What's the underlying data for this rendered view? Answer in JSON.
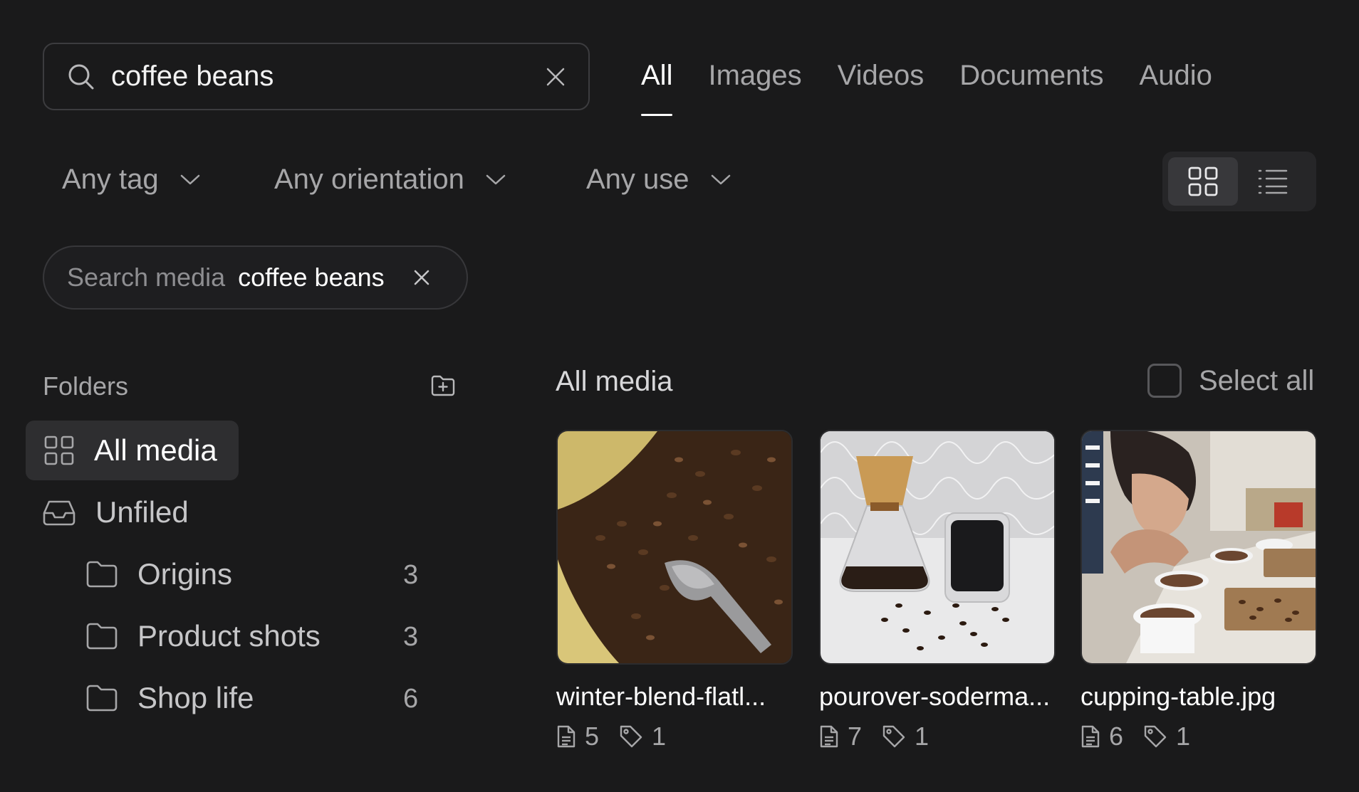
{
  "search": {
    "value": "coffee beans",
    "placeholder": "Search media"
  },
  "tabs": [
    {
      "label": "All",
      "active": true
    },
    {
      "label": "Images",
      "active": false
    },
    {
      "label": "Videos",
      "active": false
    },
    {
      "label": "Documents",
      "active": false
    },
    {
      "label": "Audio",
      "active": false
    }
  ],
  "filters": [
    {
      "label": "Any tag"
    },
    {
      "label": "Any orientation"
    },
    {
      "label": "Any use"
    }
  ],
  "view_mode": "grid",
  "chip": {
    "label": "Search media",
    "value": "coffee beans"
  },
  "sidebar": {
    "heading": "Folders",
    "items": [
      {
        "label": "All media",
        "active": true
      },
      {
        "label": "Unfiled",
        "active": false
      },
      {
        "label": "Origins",
        "count": "3"
      },
      {
        "label": "Product shots",
        "count": "3"
      },
      {
        "label": "Shop life",
        "count": "6"
      }
    ]
  },
  "main": {
    "title": "All media",
    "select_all_label": "Select all",
    "items": [
      {
        "name": "winter-blend-flatl...",
        "files": "5",
        "tags": "1",
        "thumbnail": "coffee beans in burlap sack with metal scoop"
      },
      {
        "name": "pourover-soderma...",
        "files": "7",
        "tags": "1",
        "thumbnail": "glass pour-over carafe and cup with scattered beans"
      },
      {
        "name": "cupping-table.jpg",
        "files": "6",
        "tags": "1",
        "thumbnail": "person cupping coffee at table with white cups"
      }
    ]
  },
  "colors": {
    "background": "#1a1a1b",
    "text_primary": "#ffffff",
    "text_secondary": "#a6a6a8",
    "border": "#3c3c3f",
    "active_bg": "#2e2e30"
  }
}
